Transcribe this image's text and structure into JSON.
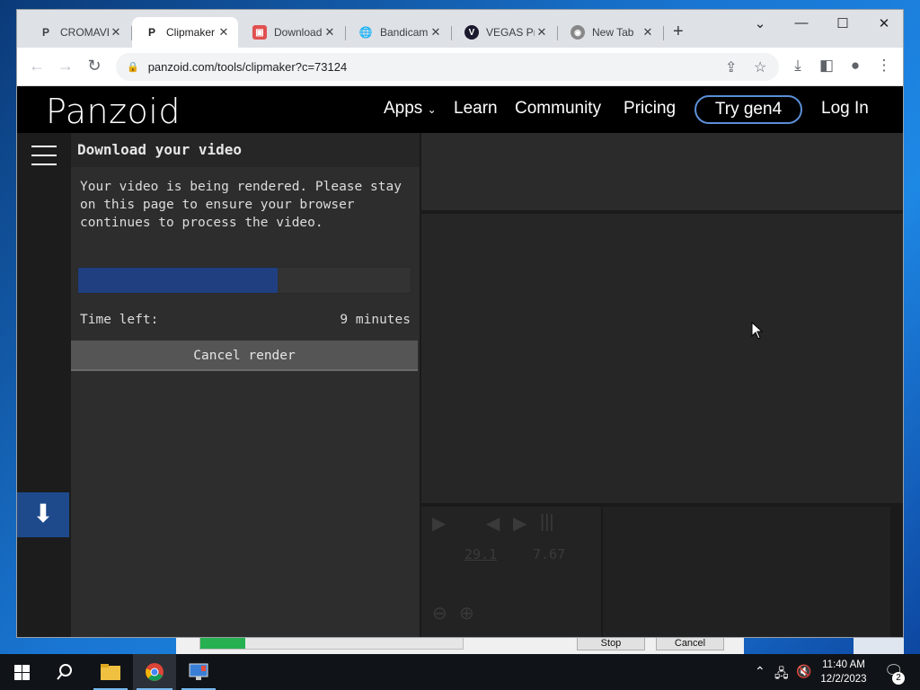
{
  "browser": {
    "tabs": [
      {
        "title": "CROMAVE",
        "favicon": "panzoid-icon",
        "active": false
      },
      {
        "title": "Clipmaker",
        "favicon": "panzoid-icon",
        "active": true
      },
      {
        "title": "Download",
        "favicon": "download-site-icon",
        "active": false
      },
      {
        "title": "Bandicam",
        "favicon": "globe-icon",
        "active": false
      },
      {
        "title": "VEGAS Pr",
        "favicon": "vegas-icon",
        "active": false
      },
      {
        "title": "New Tab",
        "favicon": "chrome-icon",
        "active": false
      }
    ],
    "url": "panzoid.com/tools/clipmaker?c=73124"
  },
  "site": {
    "logo": "Panzoid",
    "nav": {
      "apps": "Apps",
      "learn": "Learn",
      "community": "Community",
      "pricing": "Pricing",
      "try": "Try gen4",
      "login": "Log In"
    }
  },
  "render_panel": {
    "title": "Download your video",
    "message": "Your video is being rendered. Please stay on this page to ensure your browser continues to process the video.",
    "progress": 0.6,
    "time_left_label": "Time left:",
    "time_left_value": "9 minutes",
    "cancel_label": "Cancel render"
  },
  "timeline": {
    "current_time": "29.1",
    "duration": "7.67"
  },
  "background_app": {
    "progress": 0.17,
    "stop_label": "Stop",
    "cancel_label": "Cancel"
  },
  "taskbar": {
    "time": "11:40 AM",
    "date": "12/2/2023",
    "notification_count": "2"
  },
  "colors": {
    "accent_blue": "#1e4a8c",
    "progress_fill": "#1f3f80",
    "try_border": "#5b8fd6"
  }
}
